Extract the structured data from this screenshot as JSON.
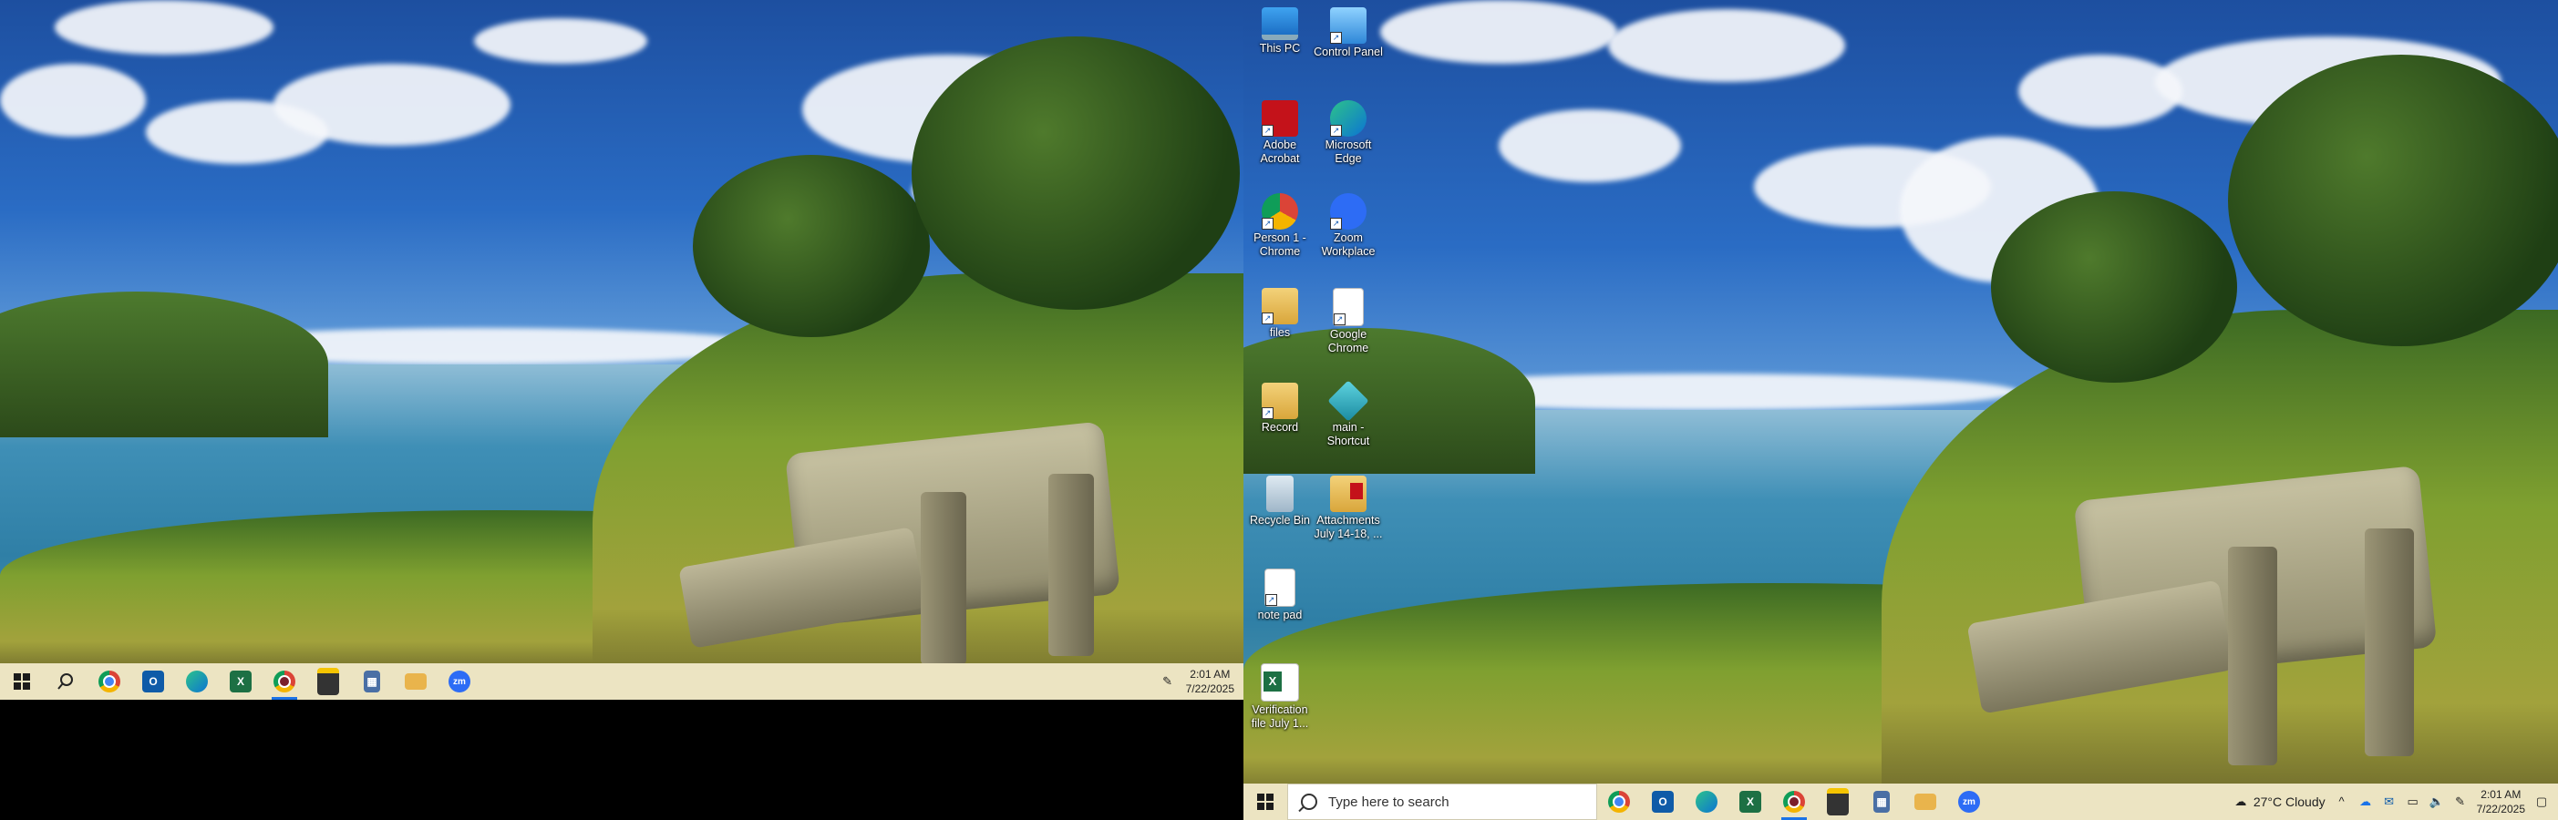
{
  "desktop_icons": [
    {
      "label": "This PC",
      "icon": "pc-icon"
    },
    {
      "label": "Control Panel",
      "icon": "control-panel-icon"
    },
    {
      "label": "Adobe Acrobat",
      "icon": "acrobat-icon"
    },
    {
      "label": "Microsoft Edge",
      "icon": "edge-icon"
    },
    {
      "label": "Person 1 - Chrome",
      "icon": "chrome-icon"
    },
    {
      "label": "Zoom Workplace",
      "icon": "zoom-icon"
    },
    {
      "label": "files",
      "icon": "folder-icon"
    },
    {
      "label": "Google Chrome",
      "icon": "document-icon"
    },
    {
      "label": "Record",
      "icon": "folder-icon"
    },
    {
      "label": "main - Shortcut",
      "icon": "app-shortcut-icon"
    },
    {
      "label": "Recycle Bin",
      "icon": "recycle-bin-icon"
    },
    {
      "label": "Attachments July 14-18, ...",
      "icon": "pdf-icon"
    },
    {
      "label": "note pad",
      "icon": "notepad-icon"
    },
    {
      "label": "Verification file July 1...",
      "icon": "excel-file-icon"
    }
  ],
  "taskbar_left": {
    "time": "2:01 AM",
    "date": "7/22/2025"
  },
  "taskbar_right": {
    "search_placeholder": "Type here to search",
    "weather": "27°C  Cloudy",
    "time": "2:01 AM",
    "date": "7/22/2025"
  },
  "colors": {
    "taskbar": "#ece4c2",
    "active_indicator": "#1a73e8"
  }
}
